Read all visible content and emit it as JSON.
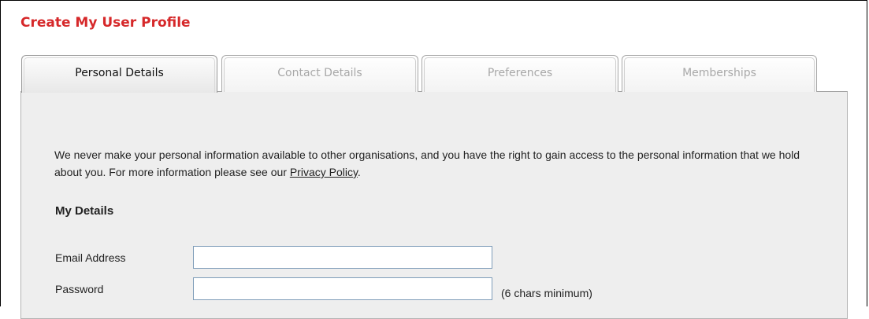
{
  "page": {
    "title": "Create My User Profile"
  },
  "tabs": [
    {
      "label": "Personal Details",
      "active": true
    },
    {
      "label": "Contact Details",
      "active": false
    },
    {
      "label": "Preferences",
      "active": false
    },
    {
      "label": "Memberships",
      "active": false
    }
  ],
  "intro": {
    "text": "We never make your personal information available to other organisations, and you have the right to gain access to the personal information that we hold about you. For more information please see our ",
    "link_label": "Privacy Policy",
    "suffix": "."
  },
  "my_details": {
    "heading": "My Details",
    "email": {
      "label": "Email Address",
      "value": ""
    },
    "password": {
      "label": "Password",
      "value": "",
      "hint": "(6 chars minimum)"
    }
  },
  "colors": {
    "title": "#d6282a",
    "panel_bg": "#eeeeee",
    "input_border": "#7f9db9"
  }
}
